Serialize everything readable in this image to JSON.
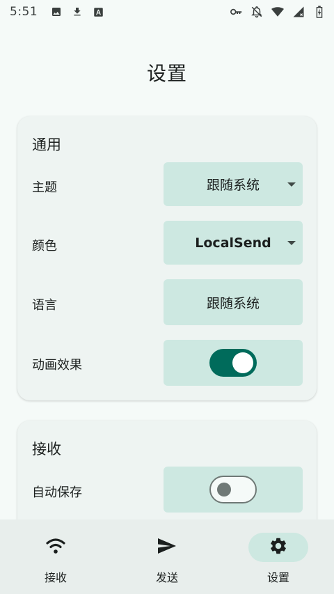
{
  "status_bar": {
    "time": "5:51",
    "left_icons": [
      "image-icon",
      "download-icon",
      "font-icon"
    ],
    "right_icons": [
      "vpn-key-icon",
      "notifications-off-icon",
      "wifi-icon",
      "signal-icon",
      "battery-icon"
    ]
  },
  "page": {
    "title": "设置"
  },
  "general": {
    "title": "通用",
    "theme": {
      "label": "主题",
      "value": "跟随系统"
    },
    "color": {
      "label": "颜色",
      "value": "LocalSend"
    },
    "language": {
      "label": "语言",
      "value": "跟随系统"
    },
    "animations": {
      "label": "动画效果",
      "enabled": true
    }
  },
  "receive": {
    "title": "接收",
    "auto_save": {
      "label": "自动保存",
      "enabled": false
    }
  },
  "nav": {
    "items": [
      {
        "label": "接收",
        "icon": "wifi-icon",
        "active": false
      },
      {
        "label": "发送",
        "icon": "send-icon",
        "active": false
      },
      {
        "label": "设置",
        "icon": "gear-icon",
        "active": true
      }
    ]
  },
  "colors": {
    "accent": "#006b5b",
    "control_bg": "#cde8e1",
    "card_bg": "#eef4f2",
    "page_bg": "#f5faf8",
    "nav_bg": "#e8eeec"
  }
}
